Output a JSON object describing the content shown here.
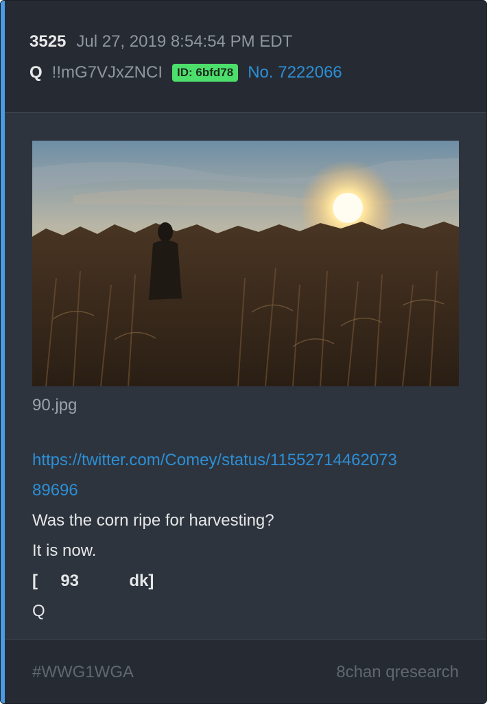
{
  "post": {
    "number": "3525",
    "date": "Jul 27, 2019 8:54:54 PM EDT",
    "author": "Q",
    "tripcode": "!!mG7VJxZNCI",
    "id_badge": "ID: 6bfd78",
    "post_no": "No. 7222066",
    "image_filename": "90.jpg",
    "url_line1": "https://twitter.com/Comey/status/11552714462073",
    "url_line2": "89696",
    "lines": [
      "Was the corn ripe for harvesting?",
      "It is now."
    ],
    "bold_line": "[     93           dk]",
    "signature": "Q"
  },
  "footer": {
    "hashtag": "#WWG1WGA",
    "source": "8chan qresearch"
  },
  "colors": {
    "accent": "#4a9be2",
    "link": "#2c8fd6",
    "id_badge": "#4ddf6b",
    "card_bg": "#2e343d"
  }
}
